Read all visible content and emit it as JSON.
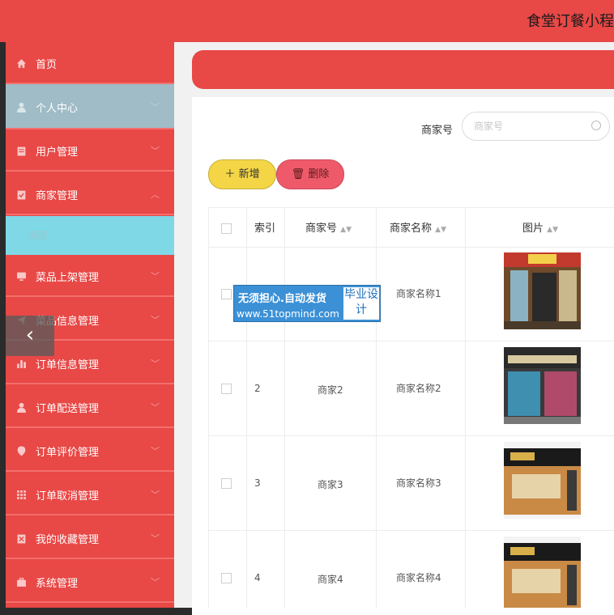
{
  "header": {
    "title": "食堂订餐小程"
  },
  "sidebar": {
    "items": [
      {
        "label": "首页",
        "icon": "home-icon"
      },
      {
        "label": "个人中心",
        "icon": "user-icon"
      },
      {
        "label": "用户管理",
        "icon": "clipboard-icon"
      },
      {
        "label": "商家管理",
        "icon": "clipboard-check-icon"
      },
      {
        "label": "菜品上架管理",
        "icon": "monitor-icon"
      },
      {
        "label": "菜品信息管理",
        "icon": "send-icon"
      },
      {
        "label": "订单信息管理",
        "icon": "bar-chart-icon"
      },
      {
        "label": "订单配送管理",
        "icon": "user-icon"
      },
      {
        "label": "订单评价管理",
        "icon": "location-icon"
      },
      {
        "label": "订单取消管理",
        "icon": "grid-icon"
      },
      {
        "label": "我的收藏管理",
        "icon": "clipboard-icon"
      },
      {
        "label": "系统管理",
        "icon": "briefcase-icon"
      }
    ],
    "subitem": "商家"
  },
  "search": {
    "label": "商家号",
    "placeholder": "商家号"
  },
  "toolbar": {
    "add_label": "新增",
    "delete_label": "删除"
  },
  "table": {
    "headers": [
      "索引",
      "商家号",
      "商家名称",
      "图片"
    ],
    "rows": [
      {
        "index": "",
        "merchant_no": "",
        "merchant_name": "商家名称1"
      },
      {
        "index": "2",
        "merchant_no": "商家2",
        "merchant_name": "商家名称2"
      },
      {
        "index": "3",
        "merchant_no": "商家3",
        "merchant_name": "商家名称3"
      },
      {
        "index": "4",
        "merchant_no": "商家4",
        "merchant_name": "商家名称4"
      }
    ]
  },
  "watermark": {
    "line1": "无须担心.自动发货",
    "line2": "www.51topmind.com",
    "badge": "毕业设计"
  },
  "colors": {
    "accent": "#e84846",
    "active": "#9fbcc7",
    "submenu": "#7ed8e6",
    "add": "#f3d546",
    "delete": "#ef5a6b"
  }
}
